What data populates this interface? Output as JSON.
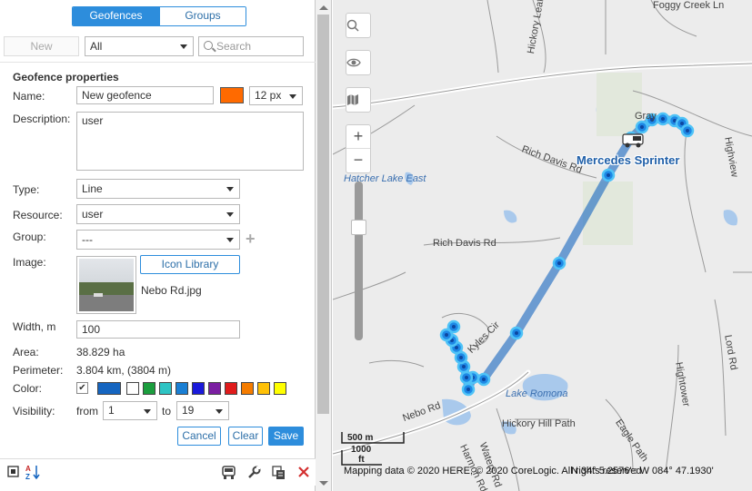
{
  "tabs": [
    {
      "label": "Geofences",
      "active": true
    },
    {
      "label": "Groups",
      "active": false
    }
  ],
  "toolbar": {
    "new_label": "New",
    "filter_value": "All",
    "search_placeholder": "Search"
  },
  "properties": {
    "title": "Geofence properties",
    "name_label": "Name:",
    "name_value": "New geofence",
    "name_color": "#ff6a00",
    "font_size": "12 px",
    "description_label": "Description:",
    "description_value": "user",
    "type_label": "Type:",
    "type_value": "Line",
    "resource_label": "Resource:",
    "resource_value": "user",
    "group_label": "Group:",
    "group_value": "---",
    "image_label": "Image:",
    "icon_library_label": "Icon Library",
    "image_filename": "Nebo Rd.jpg",
    "width_label": "Width, m",
    "width_value": "100",
    "area_label": "Area:",
    "area_value": "38.829 ha",
    "perimeter_label": "Perimeter:",
    "perimeter_value": "3.804 km, (3804 m)",
    "color_label": "Color:",
    "color_checked": true,
    "color_value": "#1565c0",
    "palette": [
      "#ffffff",
      "#1b9e3e",
      "#2ec4c4",
      "#1a7fd4",
      "#1a1adb",
      "#7b1fa2",
      "#e01b1b",
      "#f57c00",
      "#ffc107",
      "#ffff00"
    ],
    "visibility_label": "Visibility:",
    "visibility_from_label": "from",
    "visibility_from": "1",
    "visibility_to_label": "to",
    "visibility_to": "19"
  },
  "actions": {
    "cancel_label": "Cancel",
    "clear_label": "Clear",
    "save_label": "Save"
  },
  "map": {
    "vehicle_name": "Mercedes Sprinter",
    "labels": {
      "foggy_creek": "Foggy Creek Ln",
      "hickory_leaf": "Hickory Leaf Dr",
      "hatcher_lake": "Hatcher Lake East",
      "rich_davis_1": "Rich Davis Rd",
      "rich_davis_2": "Rich Davis Rd",
      "kyles_cir": "Kyles Cir",
      "nebo_rd": "Nebo Rd",
      "lake_romona": "Lake Romona",
      "hickory_hill": "Hickory Hill Path",
      "waters_rd": "Waters Rd",
      "gray": "Gray",
      "highview": "Highview",
      "hightower": "Hightower",
      "eagle_path": "Eagle Path",
      "lord_rd": "Lord Rd",
      "harmon_rd": "Harmon Rd"
    },
    "scale_metric": "500 m",
    "scale_imperial_num": "1000",
    "scale_imperial_unit": "ft",
    "attribution": "Mapping data © 2020 HERE, © 2020 CoreLogic. All rights reserved",
    "coordinates": "N 34° 5.2576' : W 084° 47.1930'"
  }
}
